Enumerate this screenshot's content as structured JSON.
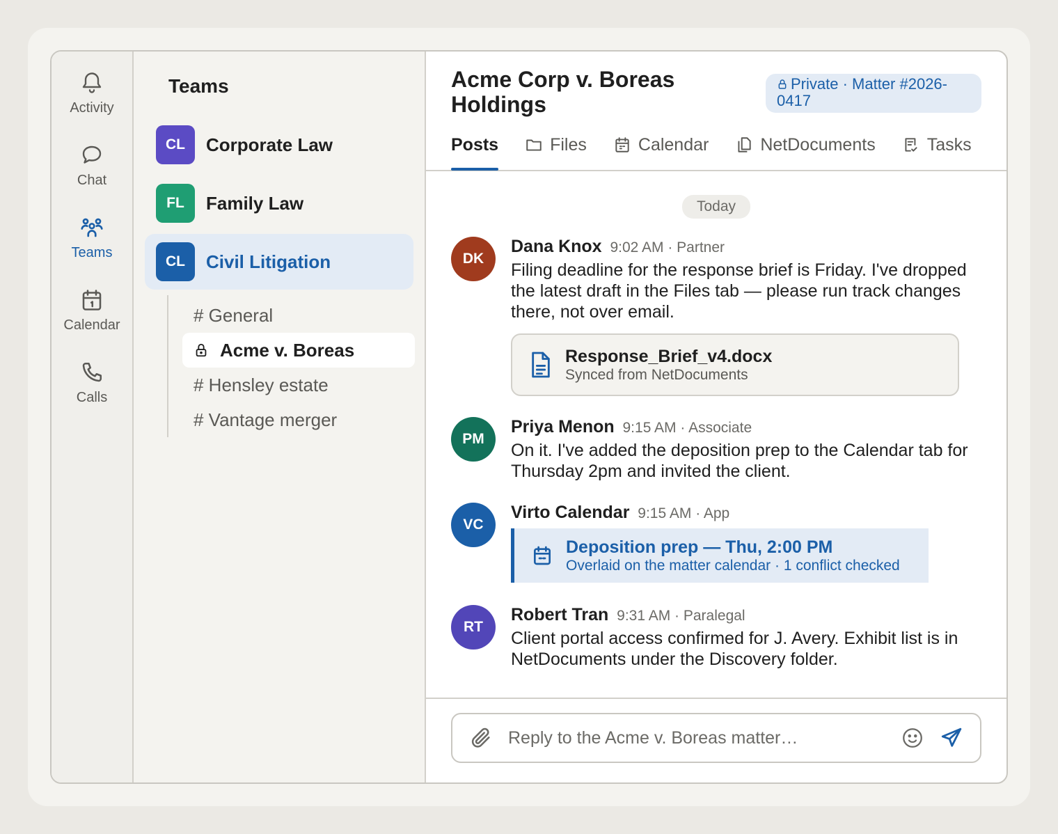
{
  "rail": [
    {
      "label": "Activity",
      "icon": "bell-icon"
    },
    {
      "label": "Chat",
      "icon": "chat-icon"
    },
    {
      "label": "Teams",
      "icon": "teams-icon"
    },
    {
      "label": "Calendar",
      "icon": "calendar-icon"
    },
    {
      "label": "Calls",
      "icon": "phone-icon"
    }
  ],
  "teams_panel": {
    "title": "Teams",
    "teams": [
      {
        "initials": "CL",
        "name": "Corporate Law",
        "color": "#5b4bc4"
      },
      {
        "initials": "FL",
        "name": "Family Law",
        "color": "#1f9e73"
      },
      {
        "initials": "CL",
        "name": "Civil Litigation",
        "color": "#1b5fa8"
      }
    ],
    "channels": [
      {
        "label": "# General"
      },
      {
        "label": "Acme v. Boreas",
        "private": true
      },
      {
        "label": "# Hensley estate"
      },
      {
        "label": "# Vantage merger"
      }
    ]
  },
  "header": {
    "title": "Acme Corp v. Boreas Holdings",
    "pill": "Private · Matter #2026-0417",
    "tabs": [
      "Posts",
      "Files",
      "Calendar",
      "NetDocuments",
      "Tasks"
    ]
  },
  "feed": {
    "day": "Today",
    "messages": [
      {
        "initials": "DK",
        "color": "#a03b1e",
        "author": "Dana Knox",
        "time": "9:02 AM",
        "role": "· Partner",
        "text": "Filing deadline for the response brief is Friday. I've dropped the latest draft in the Files tab — please run track changes there, not over email.",
        "file_name": "Response_Brief_v4.docx",
        "file_sub": "Synced from NetDocuments"
      },
      {
        "initials": "PM",
        "color": "#13725a",
        "author": "Priya Menon",
        "time": "9:15 AM",
        "role": "· Associate",
        "text": "On it. I've added the deposition prep to the Calendar tab for Thursday 2pm and invited the client."
      },
      {
        "initials": "VC",
        "color": "#1b5fa8",
        "author": "Virto Calendar",
        "time": "9:15 AM",
        "role": "· App",
        "event_title": "Deposition prep — Thu, 2:00 PM",
        "event_sub": "Overlaid on the matter calendar · 1 conflict checked"
      },
      {
        "initials": "RT",
        "color": "#5246b8",
        "author": "Robert Tran",
        "time": "9:31 AM",
        "role": "· Paralegal",
        "text": "Client portal access confirmed for J. Avery. Exhibit list is in NetDocuments under the Discovery folder."
      }
    ]
  },
  "composer": {
    "placeholder": "Reply to the Acme v. Boreas matter…"
  },
  "colors": {
    "accent": "#1b5fa8",
    "accent_bg": "#e3ebf5"
  }
}
